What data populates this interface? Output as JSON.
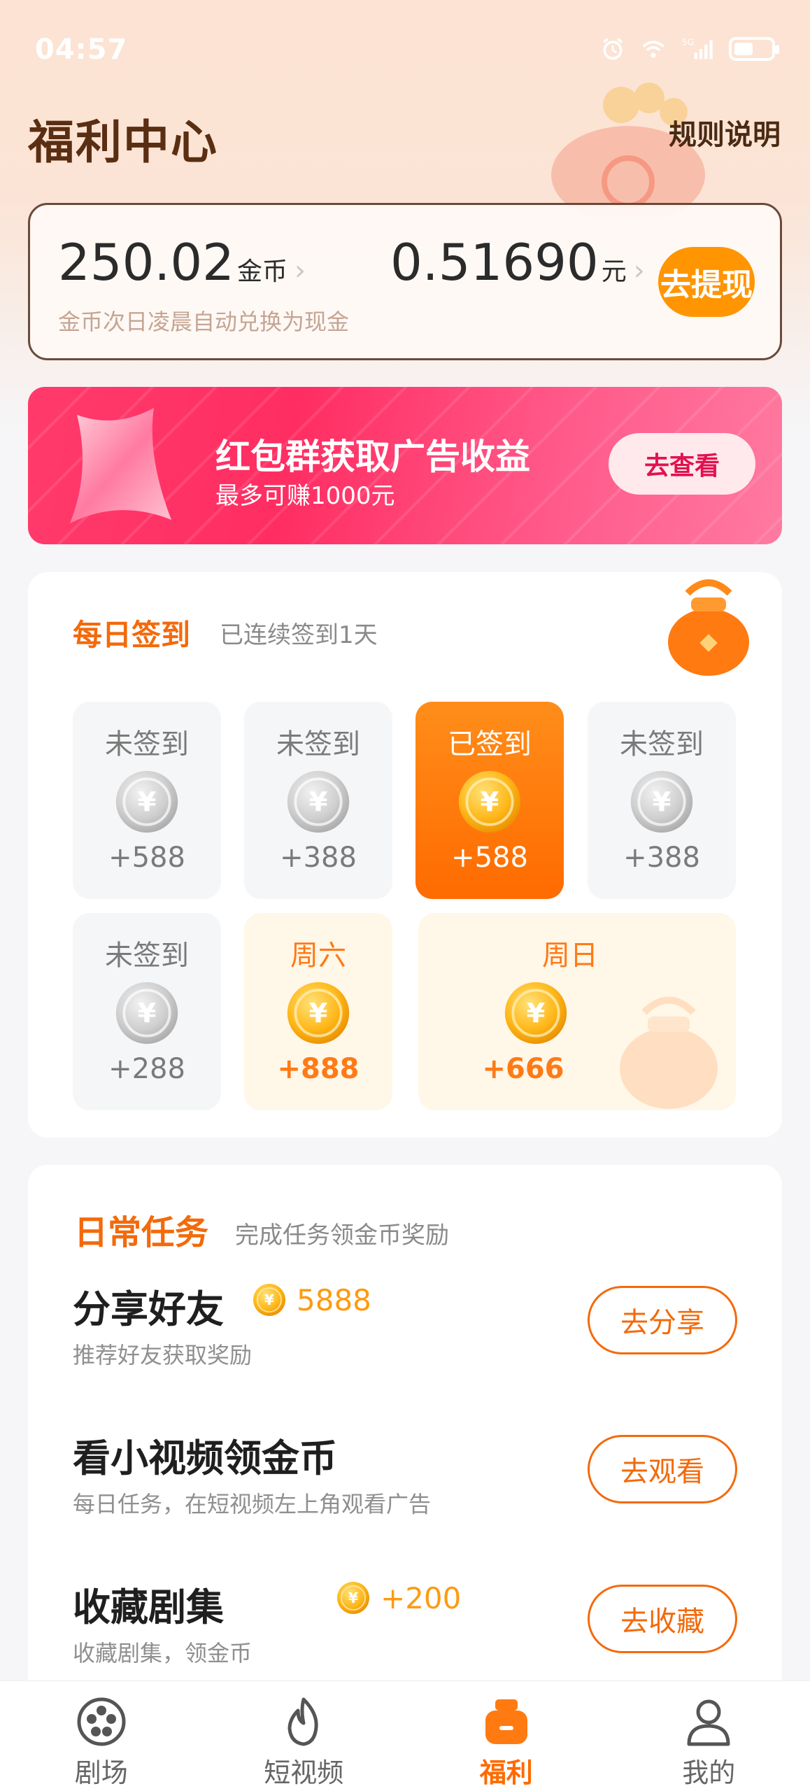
{
  "status_bar": {
    "time": "04:57",
    "network_label": "5G",
    "icons": [
      "alarm-icon",
      "wifi-icon",
      "signal-icon",
      "battery-icon"
    ]
  },
  "header": {
    "title": "福利中心",
    "rules_label": "规则说明"
  },
  "balance": {
    "coins": "250.02",
    "coins_unit": "金币",
    "cash": "0.51690",
    "cash_unit": "元",
    "note": "金币次日凌晨自动兑换为现金",
    "withdraw_label": "去提现"
  },
  "promo": {
    "title": "红包群获取广告收益",
    "subtitle": "最多可赚1000元",
    "button_label": "去查看"
  },
  "signin": {
    "title": "每日签到",
    "streak_text": "已连续签到1天",
    "days": [
      {
        "label": "未签到",
        "amount": "+588",
        "state": "pending"
      },
      {
        "label": "未签到",
        "amount": "+388",
        "state": "pending"
      },
      {
        "label": "已签到",
        "amount": "+588",
        "state": "done"
      },
      {
        "label": "未签到",
        "amount": "+388",
        "state": "pending"
      },
      {
        "label": "未签到",
        "amount": "+288",
        "state": "pending"
      },
      {
        "label": "周六",
        "amount": "+888",
        "state": "weekend"
      },
      {
        "label": "周日",
        "amount": "+666",
        "state": "weekend"
      }
    ]
  },
  "tasks": {
    "title": "日常任务",
    "subtitle": "完成任务领金币奖励",
    "items": [
      {
        "title": "分享好友",
        "reward": "5888",
        "desc": "推荐好友获取奖励",
        "button": "去分享"
      },
      {
        "title": "看小视频领金币",
        "reward": "",
        "desc": "每日任务，在短视频左上角观看广告",
        "button": "去观看"
      },
      {
        "title": "收藏剧集",
        "reward": "+200",
        "desc": "收藏剧集，领金币",
        "button": "去收藏"
      }
    ]
  },
  "nav": {
    "items": [
      {
        "label": "剧场",
        "icon": "film-reel-icon",
        "active": false
      },
      {
        "label": "短视频",
        "icon": "flame-icon",
        "active": false
      },
      {
        "label": "福利",
        "icon": "gift-bag-icon",
        "active": true
      },
      {
        "label": "我的",
        "icon": "user-icon",
        "active": false
      }
    ]
  },
  "colors": {
    "accent": "#ff6a00",
    "promo": "#ff2d62",
    "title_brown": "#5a2e12",
    "coin_gold": "#ffb21a",
    "coin_silver": "#c8c8c8"
  }
}
